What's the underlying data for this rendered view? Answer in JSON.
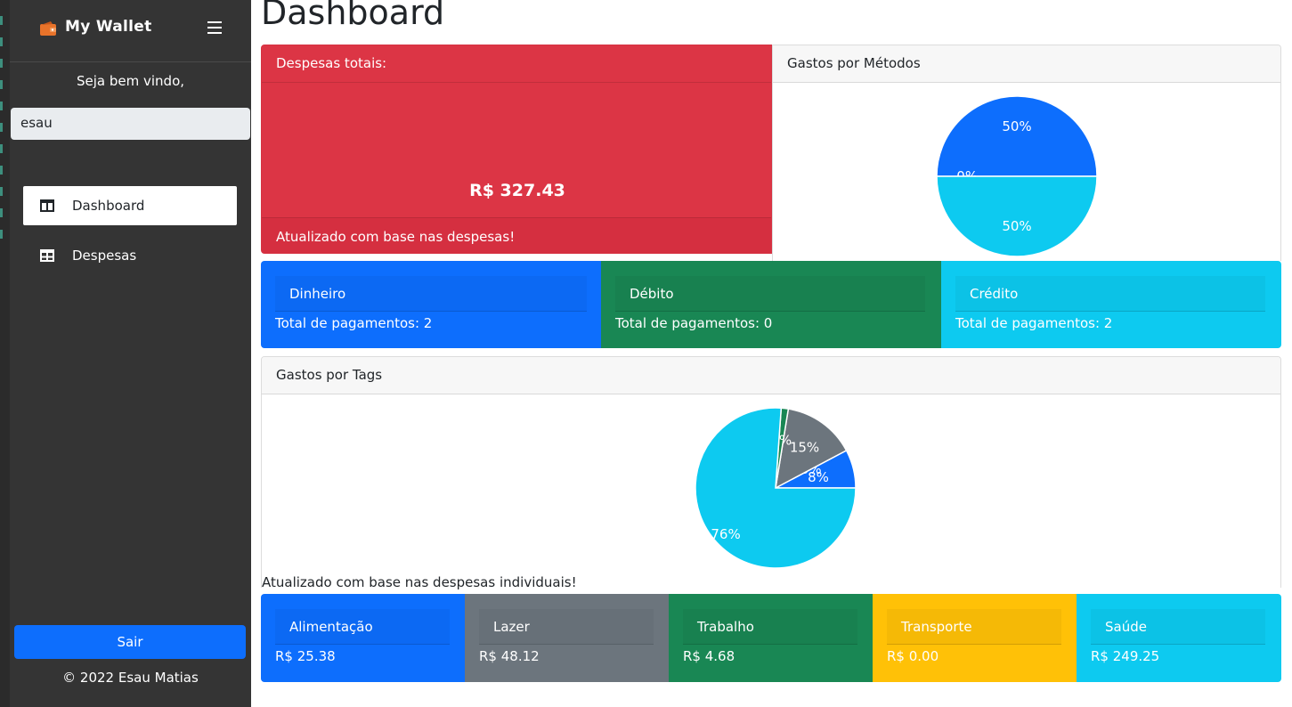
{
  "app": {
    "brand_title": "My Wallet",
    "page_title": "Dashboard"
  },
  "sidebar": {
    "welcome": "Seja bem vindo,",
    "username": "esau",
    "items": [
      {
        "label": "Dashboard",
        "icon": "layout-columns-icon",
        "active": true
      },
      {
        "label": "Despesas",
        "icon": "grid-table-icon",
        "active": false
      }
    ],
    "logout_label": "Sair",
    "footer": "© 2022 Esau Matias"
  },
  "total": {
    "header": "Despesas totais:",
    "value": "R$ 327.43",
    "footer": "Atualizado com base nas despesas!"
  },
  "methods_chart": {
    "header": "Gastos por Métodos",
    "chart_data": {
      "type": "pie",
      "categories": [
        "Dinheiro",
        "Débito",
        "Crédito"
      ],
      "values": [
        50,
        0,
        50
      ],
      "labels": [
        "50%",
        "0%",
        "50%"
      ],
      "colors": [
        "#0d6efd",
        "#198754",
        "#0dcaf0"
      ]
    }
  },
  "methods": [
    {
      "name": "Dinheiro",
      "text": "Total de pagamentos: 2",
      "color": "#0d6efd"
    },
    {
      "name": "Débito",
      "text": "Total de pagamentos: 0",
      "color": "#198754"
    },
    {
      "name": "Crédito",
      "text": "Total de pagamentos: 2",
      "color": "#0dcaf0"
    }
  ],
  "tags_chart": {
    "header": "Gastos por Tags",
    "note": "Atualizado com base nas despesas individuais!",
    "chart_data": {
      "type": "pie",
      "categories": [
        "Alimentação",
        "Transporte",
        "Lazer",
        "Trabalho",
        "Saúde"
      ],
      "values": [
        25.38,
        0.0,
        48.12,
        4.68,
        249.25
      ],
      "labels": [
        "8%",
        "0%",
        "15%",
        "1%",
        "76%"
      ],
      "colors": [
        "#0d6efd",
        "#ffc107",
        "#6c757d",
        "#198754",
        "#0dcaf0"
      ]
    }
  },
  "tags": [
    {
      "name": "Alimentação",
      "value": "R$ 25.38",
      "color": "#0d6efd"
    },
    {
      "name": "Lazer",
      "value": "R$ 48.12",
      "color": "#6c757d"
    },
    {
      "name": "Trabalho",
      "value": "R$ 4.68",
      "color": "#198754"
    },
    {
      "name": "Transporte",
      "value": "R$ 0.00",
      "color": "#ffc107"
    },
    {
      "name": "Saúde",
      "value": "R$ 249.25",
      "color": "#0dcaf0"
    }
  ]
}
